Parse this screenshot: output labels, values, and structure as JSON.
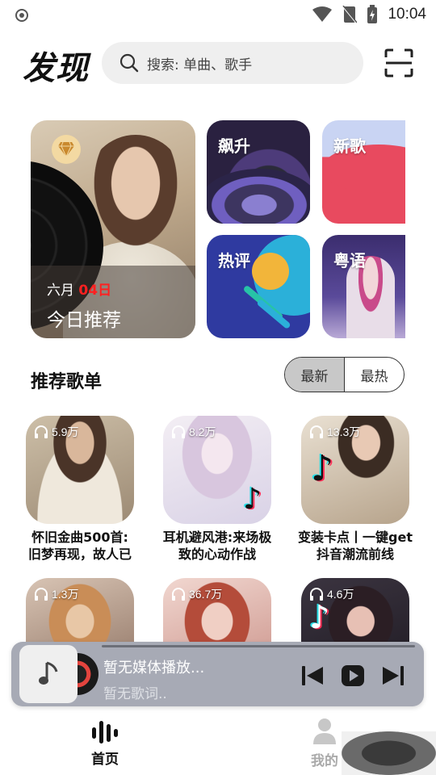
{
  "status_bar": {
    "time": "10:04"
  },
  "header": {
    "title": "发现",
    "search_placeholder": "搜索: 单曲、歌手"
  },
  "tiles": {
    "daily": {
      "month": "六月",
      "day": "04日",
      "label": "今日推荐"
    },
    "rise": "飙升",
    "new": "新歌",
    "hot": "热评",
    "cantonese": "粤语"
  },
  "playlists": {
    "title": "推荐歌单",
    "tabs": [
      "最新",
      "最热"
    ],
    "active_tab": "最新",
    "items": [
      {
        "count": "5.9万",
        "title_line1": "怀旧金曲500首:",
        "title_line2": "旧梦再现，故人已"
      },
      {
        "count": "8.2万",
        "title_line1": "耳机避风港:来场极",
        "title_line2": "致的心动作战"
      },
      {
        "count": "13.3万",
        "title_line1": "变装卡点丨一键get",
        "title_line2": "抖音潮流前线"
      },
      {
        "count": "1.3万",
        "title_line1": "",
        "title_line2": ""
      },
      {
        "count": "36.7万",
        "title_line1": "",
        "title_line2": ""
      },
      {
        "count": "4.6万",
        "title_line1": "",
        "title_line2": ""
      }
    ]
  },
  "player": {
    "song": "暂无媒体播放...",
    "lyric": "暂无歌词.."
  },
  "nav": {
    "home": "首页",
    "mine": "我的"
  },
  "colors": {
    "accent_red": "#ff2020",
    "player_bg": "#a7aab5"
  },
  "icons": [
    "search-icon",
    "scan-icon",
    "headphones-icon",
    "prev-icon",
    "play-icon",
    "next-icon",
    "music-note-icon",
    "equalizer-icon",
    "user-icon"
  ]
}
